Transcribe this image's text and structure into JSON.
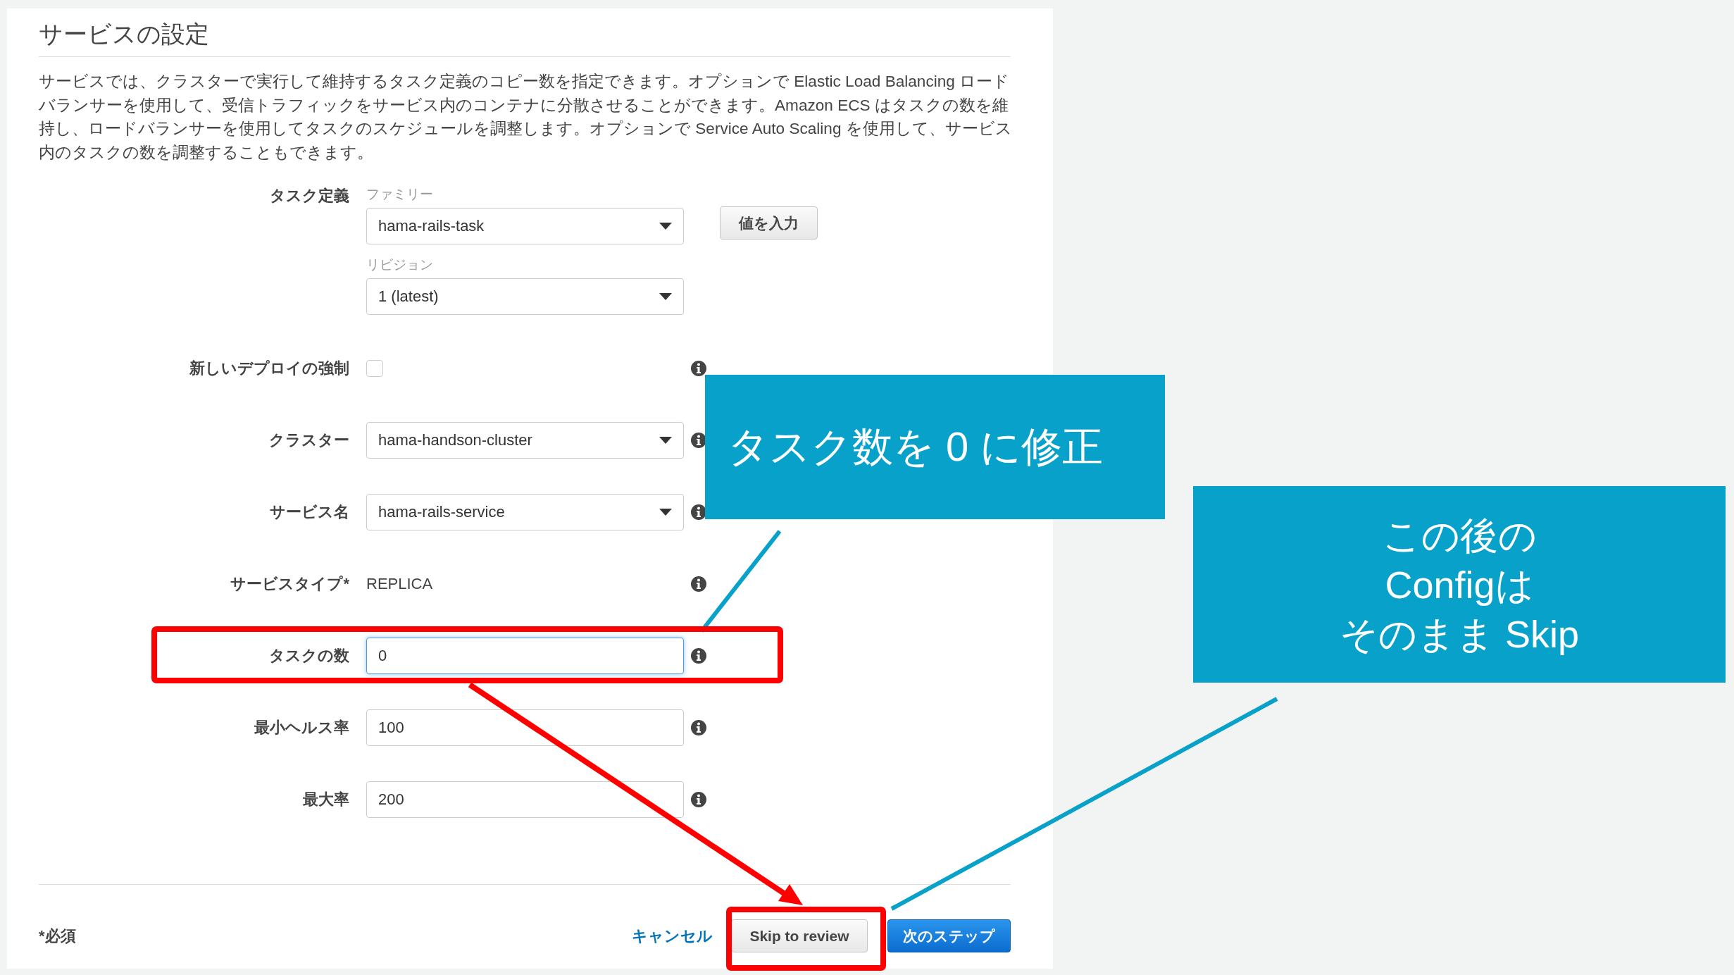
{
  "section": {
    "title": "サービスの設定",
    "description": "サービスでは、クラスターで実行して維持するタスク定義のコピー数を指定できます。オプションで Elastic Load Balancing ロードバランサーを使用して、受信トラフィックをサービス内のコンテナに分散させることができます。Amazon ECS はタスクの数を維持し、ロードバランサーを使用してタスクのスケジュールを調整します。オプションで Service Auto Scaling を使用して、サービス内のタスクの数を調整することもできます。"
  },
  "form": {
    "rows": [
      {
        "kind": "task_definition",
        "label": "タスク定義",
        "family_label": "ファミリー",
        "family": "hama-rails-task",
        "revision_label": "リビジョン",
        "revision": "1 (latest)",
        "button": "値を入力"
      },
      {
        "kind": "checkbox",
        "label": "新しいデプロイの強制",
        "checked": false
      },
      {
        "kind": "select",
        "label": "クラスター",
        "value": "hama-handson-cluster"
      },
      {
        "kind": "select",
        "label": "サービス名",
        "value": "hama-rails-service"
      },
      {
        "kind": "text",
        "label": "サービスタイプ*",
        "value": "REPLICA"
      },
      {
        "kind": "input",
        "label": "タスクの数",
        "value": "0",
        "focused": true
      },
      {
        "kind": "input",
        "label": "最小ヘルス率",
        "value": "100",
        "focused": false
      },
      {
        "kind": "input",
        "label": "最大率",
        "value": "200",
        "focused": false
      }
    ]
  },
  "footer": {
    "required_note": "*必須",
    "cancel": "キャンセル",
    "buttons": [
      {
        "label": "Skip to review",
        "kind": "secondary"
      },
      {
        "label": "次のステップ",
        "kind": "primary"
      }
    ]
  },
  "callouts": [
    {
      "lines": [
        "タスク数を 0 に修正"
      ]
    },
    {
      "lines": [
        "この後の",
        "Configは",
        "そのまま Skip"
      ]
    }
  ]
}
